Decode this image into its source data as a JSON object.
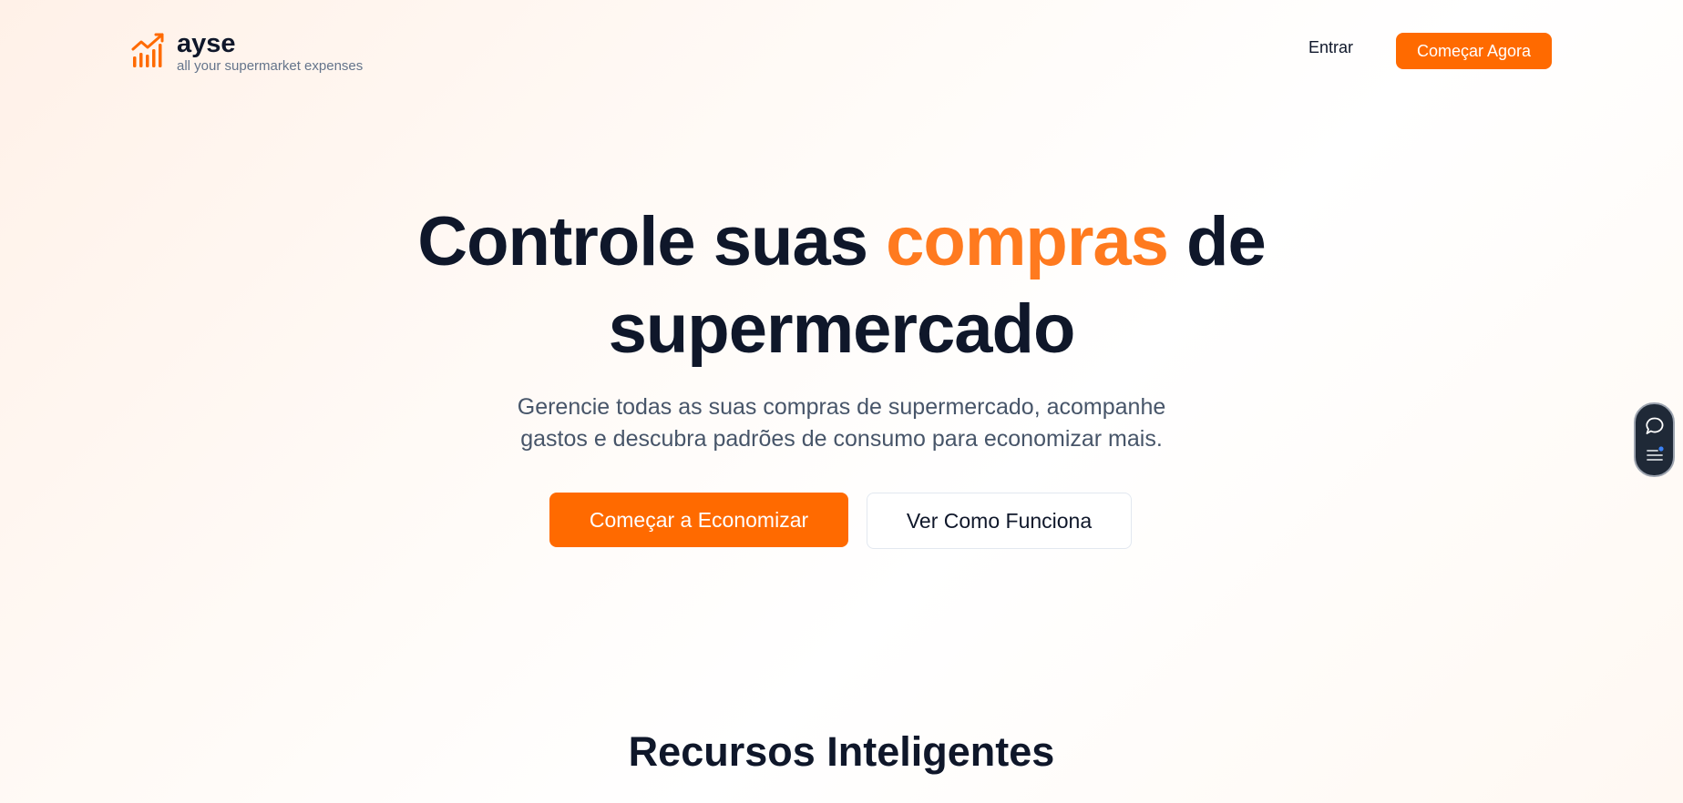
{
  "brand": {
    "name": "ayse",
    "tagline": "all your supermarket expenses",
    "accent_color": "#ff6a00"
  },
  "nav": {
    "login_label": "Entrar",
    "cta_label": "Começar Agora"
  },
  "hero": {
    "title_part1": "Controle suas ",
    "title_accent": "compras",
    "title_part2": " de",
    "title_line2": "supermercado",
    "subtitle_line1": "Gerencie todas as suas compras de supermercado, acompanhe",
    "subtitle_line2": "gastos e descubra padrões de consumo para economizar mais.",
    "primary_button": "Começar a Economizar",
    "secondary_button": "Ver Como Funciona"
  },
  "features": {
    "title": "Recursos Inteligentes"
  },
  "widget": {
    "icons": [
      "chat-bubble-icon",
      "menu-list-icon"
    ]
  }
}
